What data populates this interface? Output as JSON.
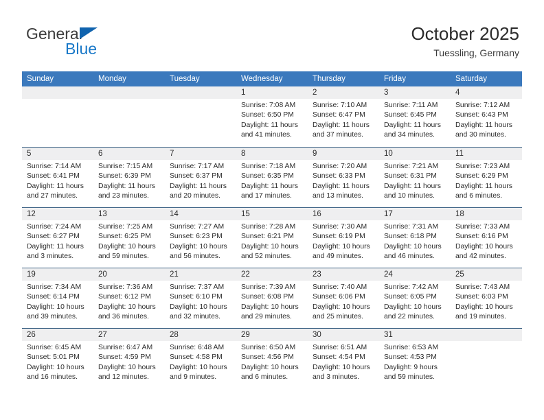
{
  "brand": {
    "name_top": "General",
    "name_bottom": "Blue",
    "triangle_color": "#1063ae",
    "text_color_top": "#3c3c3c",
    "text_color_bottom": "#1878c8",
    "icon": "triangle-logo-icon"
  },
  "header": {
    "title": "October 2025",
    "subtitle": "Tuessling, Germany"
  },
  "theme": {
    "header_bg": "#3b79bd",
    "header_text": "#ffffff",
    "row_border": "#3c6284",
    "daynum_band_bg": "#efeff0",
    "body_bg": "#ffffff",
    "text": "#2c2c2c"
  },
  "weekday_headers": [
    "Sunday",
    "Monday",
    "Tuesday",
    "Wednesday",
    "Thursday",
    "Friday",
    "Saturday"
  ],
  "labels": {
    "sunrise_prefix": "Sunrise:",
    "sunset_prefix": "Sunset:",
    "daylight_prefix": "Daylight:"
  },
  "weeks": [
    [
      {
        "day": "",
        "empty": true
      },
      {
        "day": "",
        "empty": true
      },
      {
        "day": "",
        "empty": true
      },
      {
        "day": "1",
        "sunrise": "Sunrise: 7:08 AM",
        "sunset": "Sunset: 6:50 PM",
        "daylight": "Daylight: 11 hours and 41 minutes."
      },
      {
        "day": "2",
        "sunrise": "Sunrise: 7:10 AM",
        "sunset": "Sunset: 6:47 PM",
        "daylight": "Daylight: 11 hours and 37 minutes."
      },
      {
        "day": "3",
        "sunrise": "Sunrise: 7:11 AM",
        "sunset": "Sunset: 6:45 PM",
        "daylight": "Daylight: 11 hours and 34 minutes."
      },
      {
        "day": "4",
        "sunrise": "Sunrise: 7:12 AM",
        "sunset": "Sunset: 6:43 PM",
        "daylight": "Daylight: 11 hours and 30 minutes."
      }
    ],
    [
      {
        "day": "5",
        "sunrise": "Sunrise: 7:14 AM",
        "sunset": "Sunset: 6:41 PM",
        "daylight": "Daylight: 11 hours and 27 minutes."
      },
      {
        "day": "6",
        "sunrise": "Sunrise: 7:15 AM",
        "sunset": "Sunset: 6:39 PM",
        "daylight": "Daylight: 11 hours and 23 minutes."
      },
      {
        "day": "7",
        "sunrise": "Sunrise: 7:17 AM",
        "sunset": "Sunset: 6:37 PM",
        "daylight": "Daylight: 11 hours and 20 minutes."
      },
      {
        "day": "8",
        "sunrise": "Sunrise: 7:18 AM",
        "sunset": "Sunset: 6:35 PM",
        "daylight": "Daylight: 11 hours and 17 minutes."
      },
      {
        "day": "9",
        "sunrise": "Sunrise: 7:20 AM",
        "sunset": "Sunset: 6:33 PM",
        "daylight": "Daylight: 11 hours and 13 minutes."
      },
      {
        "day": "10",
        "sunrise": "Sunrise: 7:21 AM",
        "sunset": "Sunset: 6:31 PM",
        "daylight": "Daylight: 11 hours and 10 minutes."
      },
      {
        "day": "11",
        "sunrise": "Sunrise: 7:23 AM",
        "sunset": "Sunset: 6:29 PM",
        "daylight": "Daylight: 11 hours and 6 minutes."
      }
    ],
    [
      {
        "day": "12",
        "sunrise": "Sunrise: 7:24 AM",
        "sunset": "Sunset: 6:27 PM",
        "daylight": "Daylight: 11 hours and 3 minutes."
      },
      {
        "day": "13",
        "sunrise": "Sunrise: 7:25 AM",
        "sunset": "Sunset: 6:25 PM",
        "daylight": "Daylight: 10 hours and 59 minutes."
      },
      {
        "day": "14",
        "sunrise": "Sunrise: 7:27 AM",
        "sunset": "Sunset: 6:23 PM",
        "daylight": "Daylight: 10 hours and 56 minutes."
      },
      {
        "day": "15",
        "sunrise": "Sunrise: 7:28 AM",
        "sunset": "Sunset: 6:21 PM",
        "daylight": "Daylight: 10 hours and 52 minutes."
      },
      {
        "day": "16",
        "sunrise": "Sunrise: 7:30 AM",
        "sunset": "Sunset: 6:19 PM",
        "daylight": "Daylight: 10 hours and 49 minutes."
      },
      {
        "day": "17",
        "sunrise": "Sunrise: 7:31 AM",
        "sunset": "Sunset: 6:18 PM",
        "daylight": "Daylight: 10 hours and 46 minutes."
      },
      {
        "day": "18",
        "sunrise": "Sunrise: 7:33 AM",
        "sunset": "Sunset: 6:16 PM",
        "daylight": "Daylight: 10 hours and 42 minutes."
      }
    ],
    [
      {
        "day": "19",
        "sunrise": "Sunrise: 7:34 AM",
        "sunset": "Sunset: 6:14 PM",
        "daylight": "Daylight: 10 hours and 39 minutes."
      },
      {
        "day": "20",
        "sunrise": "Sunrise: 7:36 AM",
        "sunset": "Sunset: 6:12 PM",
        "daylight": "Daylight: 10 hours and 36 minutes."
      },
      {
        "day": "21",
        "sunrise": "Sunrise: 7:37 AM",
        "sunset": "Sunset: 6:10 PM",
        "daylight": "Daylight: 10 hours and 32 minutes."
      },
      {
        "day": "22",
        "sunrise": "Sunrise: 7:39 AM",
        "sunset": "Sunset: 6:08 PM",
        "daylight": "Daylight: 10 hours and 29 minutes."
      },
      {
        "day": "23",
        "sunrise": "Sunrise: 7:40 AM",
        "sunset": "Sunset: 6:06 PM",
        "daylight": "Daylight: 10 hours and 25 minutes."
      },
      {
        "day": "24",
        "sunrise": "Sunrise: 7:42 AM",
        "sunset": "Sunset: 6:05 PM",
        "daylight": "Daylight: 10 hours and 22 minutes."
      },
      {
        "day": "25",
        "sunrise": "Sunrise: 7:43 AM",
        "sunset": "Sunset: 6:03 PM",
        "daylight": "Daylight: 10 hours and 19 minutes."
      }
    ],
    [
      {
        "day": "26",
        "sunrise": "Sunrise: 6:45 AM",
        "sunset": "Sunset: 5:01 PM",
        "daylight": "Daylight: 10 hours and 16 minutes."
      },
      {
        "day": "27",
        "sunrise": "Sunrise: 6:47 AM",
        "sunset": "Sunset: 4:59 PM",
        "daylight": "Daylight: 10 hours and 12 minutes."
      },
      {
        "day": "28",
        "sunrise": "Sunrise: 6:48 AM",
        "sunset": "Sunset: 4:58 PM",
        "daylight": "Daylight: 10 hours and 9 minutes."
      },
      {
        "day": "29",
        "sunrise": "Sunrise: 6:50 AM",
        "sunset": "Sunset: 4:56 PM",
        "daylight": "Daylight: 10 hours and 6 minutes."
      },
      {
        "day": "30",
        "sunrise": "Sunrise: 6:51 AM",
        "sunset": "Sunset: 4:54 PM",
        "daylight": "Daylight: 10 hours and 3 minutes."
      },
      {
        "day": "31",
        "sunrise": "Sunrise: 6:53 AM",
        "sunset": "Sunset: 4:53 PM",
        "daylight": "Daylight: 9 hours and 59 minutes."
      },
      {
        "day": "",
        "empty": true
      }
    ]
  ]
}
